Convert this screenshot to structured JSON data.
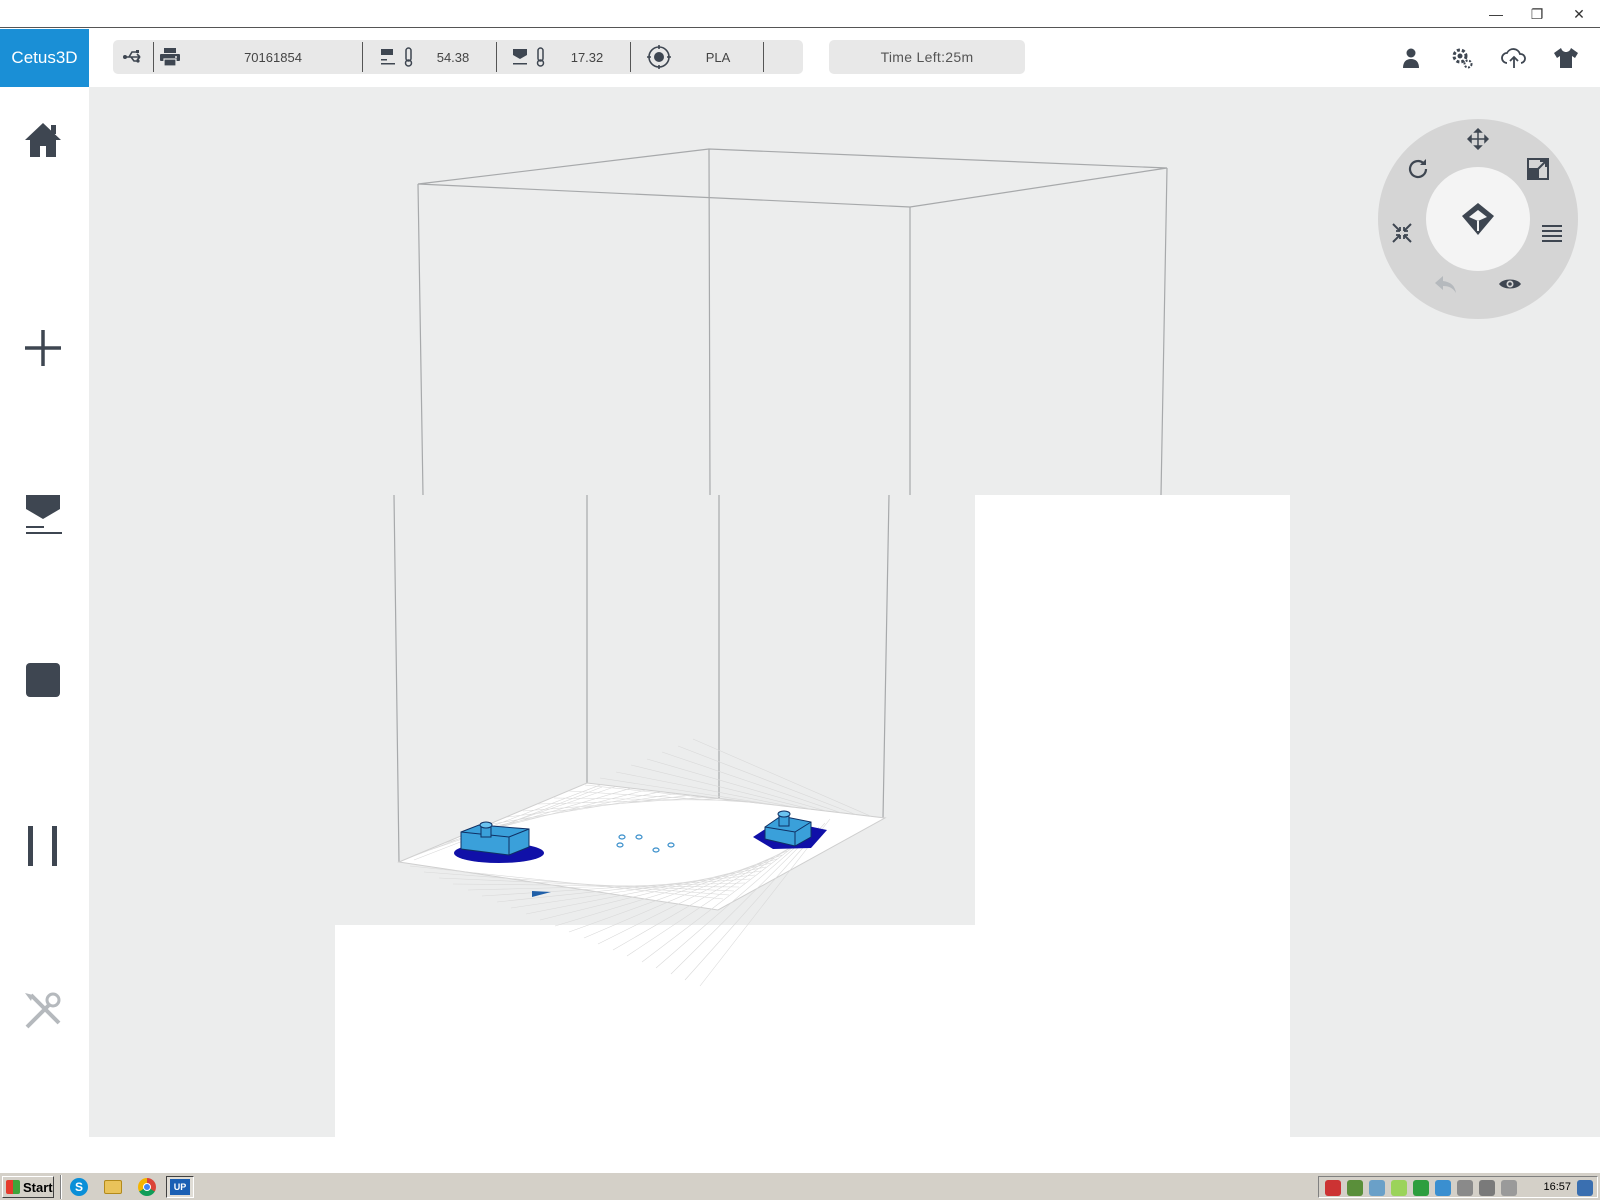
{
  "app": {
    "brand": "Cetus3D"
  },
  "window_controls": {
    "minimize": "—",
    "restore": "❐",
    "close": "✕"
  },
  "status": {
    "printer_id": "70161854",
    "nozzle_temp": "54.38",
    "bed_temp": "17.32",
    "material": "PLA",
    "time_left": "Time Left:25m"
  },
  "colors": {
    "brand": "#1a8fd6",
    "viewport_bg": "#eceded",
    "icon": "#3e4651",
    "model": "#3aa0da",
    "raft": "#1010a8"
  },
  "top_icons": [
    "user-icon",
    "settings-icon",
    "cloud-upload-icon",
    "shirt-icon"
  ],
  "sidebar_icons": [
    "home-icon",
    "add-icon",
    "print-icon",
    "stop-icon",
    "pause-icon",
    "tools-icon"
  ],
  "wheel_icons": [
    "move-icon",
    "rotate-icon",
    "scale-icon",
    "reset-icon",
    "menu-icon",
    "undo-icon",
    "view-icon",
    "logo-icon"
  ],
  "taskbar": {
    "start_label": "Start",
    "clock": "16:57",
    "apps": [
      "skype-icon",
      "explorer-icon",
      "chrome-icon",
      "up-studio-icon"
    ],
    "up_label": "UP"
  }
}
